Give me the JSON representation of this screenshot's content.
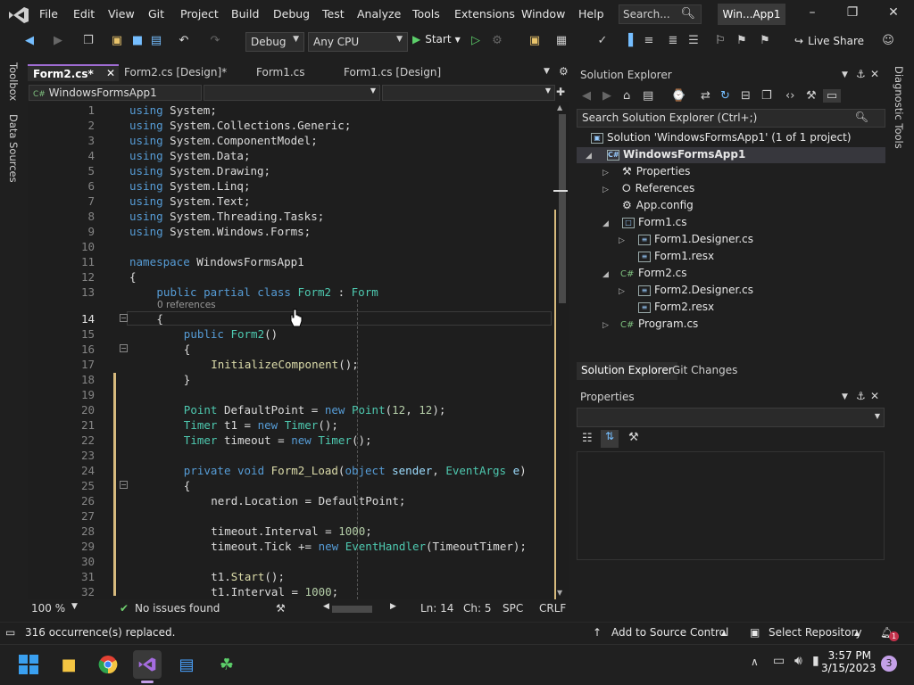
{
  "menu": [
    "File",
    "Edit",
    "View",
    "Git",
    "Project",
    "Build",
    "Debug",
    "Test",
    "Analyze",
    "Tools",
    "Extensions",
    "Window",
    "Help"
  ],
  "search": {
    "label": "Search..."
  },
  "app_title": "Win...App1",
  "toolbar": {
    "config": "Debug",
    "platform": "Any CPU",
    "start_label": "Start",
    "liveshare": "Live Share"
  },
  "left_tabs": [
    "Toolbox",
    "Data Sources"
  ],
  "doc_tabs": [
    "Form2.cs*",
    "Form2.cs [Design]*",
    "Form1.cs",
    "Form1.cs [Design]"
  ],
  "nav": {
    "project": "WindowsFormsApp1"
  },
  "code": {
    "line_numbers": [
      "1",
      "2",
      "3",
      "4",
      "5",
      "6",
      "7",
      "8",
      "9",
      "10",
      "11",
      "12",
      "13",
      "14",
      "15",
      "16",
      "17",
      "18",
      "19",
      "20",
      "21",
      "22",
      "23",
      "24",
      "25",
      "26",
      "27",
      "28",
      "29",
      "30",
      "31",
      "32"
    ],
    "references": "0 references"
  },
  "editor_status": {
    "zoom": "100 %",
    "issues": "No issues found",
    "ln": "Ln: 14",
    "ch": "Ch: 5",
    "spc": "SPC",
    "crlf": "CRLF"
  },
  "solution_explorer": {
    "title": "Solution Explorer",
    "search_placeholder": "Search Solution Explorer (Ctrl+;)",
    "tree": [
      "Solution 'WindowsFormsApp1' (1 of 1 project)",
      "WindowsFormsApp1",
      "Properties",
      "References",
      "App.config",
      "Form1.cs",
      "Form1.Designer.cs",
      "Form1.resx",
      "Form2.cs",
      "Form2.Designer.cs",
      "Form2.resx",
      "Program.cs"
    ],
    "bottom_tabs": [
      "Solution Explorer",
      "Git Changes"
    ]
  },
  "properties": {
    "title": "Properties"
  },
  "right_tabs": [
    "Diagnostic Tools"
  ],
  "statusbar": {
    "message": "316 occurrence(s) replaced.",
    "source_control": "Add to Source Control",
    "repo": "Select Repository",
    "notif_count": "1"
  },
  "taskbar": {
    "time": "3:57 PM",
    "date": "3/15/2023",
    "badge": "3"
  }
}
